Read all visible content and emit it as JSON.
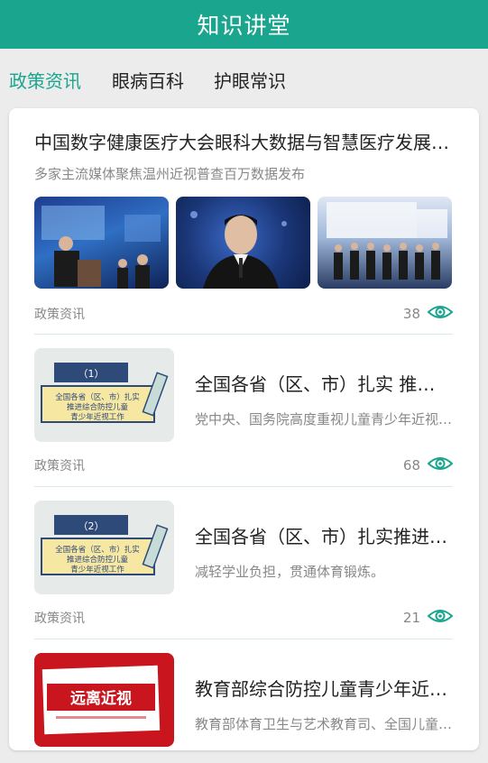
{
  "app": {
    "title": "知识讲堂"
  },
  "tabs": [
    {
      "label": "政策资讯",
      "active": true
    },
    {
      "label": "眼病百科",
      "active": false
    },
    {
      "label": "护眼常识",
      "active": false
    }
  ],
  "colors": {
    "accent": "#1aa58e"
  },
  "articles": [
    {
      "title": "中国数字健康医疗大会眼科大数据与智慧医疗发展论坛在京举行",
      "subtitle": "多家主流媒体聚焦温州近视普查百万数据发布",
      "category": "政策资讯",
      "views": "38",
      "images": [
        "conference-speaker-photo",
        "conference-portrait-photo",
        "conference-panel-photo"
      ]
    },
    {
      "title": "全国各省（区、市）扎实 推进综合防控儿童青少年近视工作",
      "subtitle": "党中央、国务院高度重视儿童青少年近视防控工作",
      "category": "政策资讯",
      "views": "68",
      "poster": {
        "badge": "（1）",
        "lines": [
          "全国各省（区、市）扎实",
          "推进综合防控儿童",
          "青少年近视工作"
        ]
      }
    },
    {
      "title": "全国各省（区、市）扎实推进综合防控儿童青少年近视工作",
      "subtitle": "减轻学业负担，贯通体育锻炼。",
      "category": "政策资讯",
      "views": "21",
      "poster": {
        "badge": "（2）",
        "lines": [
          "全国各省（区、市）扎实",
          "推进综合防控儿童",
          "青少年近视工作"
        ]
      }
    },
    {
      "title": "教育部综合防控儿童青少年近视专项检查",
      "subtitle": "教育部体育卫生与艺术教育司、全国儿童青少年近视防控",
      "poster": {
        "text": "远离近视"
      }
    }
  ]
}
